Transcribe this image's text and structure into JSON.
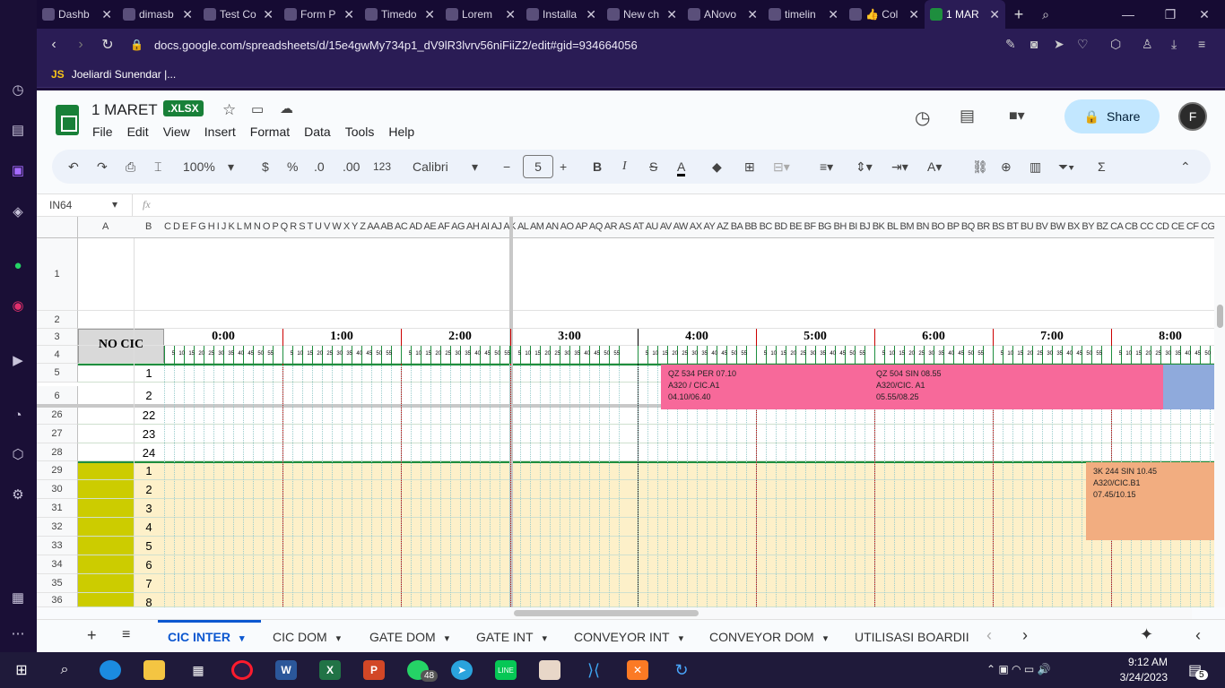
{
  "browser_tabs": [
    {
      "label": "Dashb",
      "icon": "gamepad-icon"
    },
    {
      "label": "dimasb",
      "icon": "github-icon"
    },
    {
      "label": "Test Co",
      "icon": "notion-icon"
    },
    {
      "label": "Form P",
      "icon": "form-icon"
    },
    {
      "label": "Timedo",
      "icon": "notion-icon"
    },
    {
      "label": "Lorem",
      "icon": "l-icon"
    },
    {
      "label": "Installa",
      "icon": "laravel-icon"
    },
    {
      "label": "New ch",
      "icon": "openai-icon"
    },
    {
      "label": "ANovo",
      "icon": "github-icon"
    },
    {
      "label": "timelin",
      "icon": "github-icon"
    },
    {
      "label": "👍 Col",
      "icon": "pin-icon"
    },
    {
      "label": "1 MAR",
      "icon": "sheets-icon"
    }
  ],
  "address": {
    "url": "docs.google.com/spreadsheets/d/15e4gwMy734p1_dV9lR3lvrv56niFiiZ2/edit#gid=934664056"
  },
  "bookmark": {
    "badge": "JS",
    "label": "Joeliardi Sunendar |..."
  },
  "doc": {
    "title": "1 MARET",
    "badge": ".XLSX"
  },
  "menu": [
    "File",
    "Edit",
    "View",
    "Insert",
    "Format",
    "Data",
    "Tools",
    "Help"
  ],
  "share_label": "Share",
  "toolbar": {
    "zoom": "100%",
    "currency": "$",
    "percent": "%",
    "dec_less": ".0",
    "dec_more": ".00",
    "format": "123",
    "font": "Calibri",
    "font_size": "5"
  },
  "name_box": "IN64",
  "fx": "fx",
  "col_letters": "C D E F G H I J K L M N O P Q R S T U V W X Y Z AA AB AC AD AE AF AG AH AI AJ AK AL AM AN AO AP AQ AR AS AT AU AV AW AX AY AZ BA BB BC BD BE BF BG BH BI BJ BK BL BM BN BO BP BQ BR BS BT BU BV BW BX BY BZ CA CB CC CD CE CF CG CH CI CJ CK CL CM CN CO CP CQ CR CS CT CU CV CW CX CY CZ DA DB DC DD",
  "col_a": "A",
  "col_b": "B",
  "row_numbers": [
    "1",
    "2",
    "3",
    "4",
    "5",
    "6",
    "26",
    "27",
    "28",
    "29",
    "30",
    "31",
    "32",
    "33",
    "34",
    "35",
    "36"
  ],
  "header_label": "NO CIC",
  "hours": [
    "0:00",
    "1:00",
    "2:00",
    "3:00",
    "4:00",
    "5:00",
    "6:00",
    "7:00",
    "8:00"
  ],
  "minute_ticks": [
    "5",
    "10",
    "15",
    "20",
    "25",
    "30",
    "35",
    "40",
    "45",
    "50",
    "55"
  ],
  "cic_numbers": [
    "1",
    "2",
    "22",
    "23",
    "24",
    "1",
    "2",
    "3",
    "4",
    "5",
    "6",
    "7",
    "8"
  ],
  "flights": [
    {
      "line1": "QZ 534 PER 07.10",
      "line2": "A320 / CIC.A1",
      "line3": "04.10/06.40",
      "color": "#f7699a"
    },
    {
      "line1": "QZ 504 SIN 08.55",
      "line2": "A320/CIC. A1",
      "line3": "05.55/08.25",
      "color": "#f7699a"
    },
    {
      "line1": "3K 244 SIN 10.45",
      "line2": "A320/CIC.B1",
      "line3": "07.45/10.15",
      "color": "#f2ad80"
    }
  ],
  "sheet_tabs": [
    "CIC INTER",
    "CIC DOM",
    "GATE DOM",
    "GATE INT",
    "CONVEYOR INT",
    "CONVEYOR DOM",
    "UTILISASI BOARDII"
  ],
  "taskbar": {
    "time": "9:12 AM",
    "date": "3/24/2023",
    "whatsapp_count": "48",
    "notif_count": "5"
  }
}
